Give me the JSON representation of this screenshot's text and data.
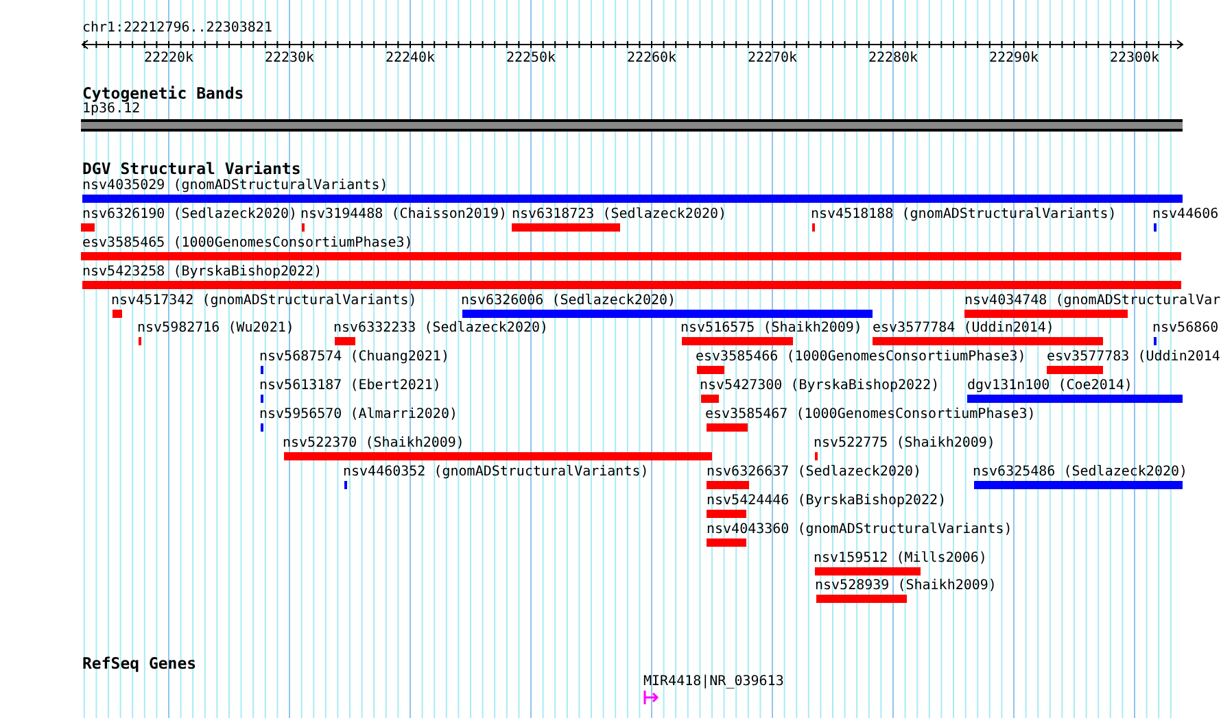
{
  "ruler": {
    "position": "chr1:22212796..22303821",
    "ticks": [
      "22220k",
      "22230k",
      "22240k",
      "22250k",
      "22260k",
      "22270k",
      "22280k",
      "22290k",
      "22300k"
    ]
  },
  "tracks": [
    {
      "kind": "cytoband",
      "title": "Cytogenetic Bands",
      "band": "1p36.12"
    },
    {
      "kind": "variants",
      "title": "DGV Structural Variants",
      "rows": [
        [
          {
            "label": "nsv4035029 (gnomADStructuralVariants)",
            "color": "#0000ff"
          }
        ],
        [
          {
            "label": "nsv6326190 (Sedlazeck2020)",
            "color": "#ff0000"
          },
          {
            "label": "nsv3194488 (Chaisson2019)",
            "color": "#ff0000"
          },
          {
            "label": "nsv6318723 (Sedlazeck2020)",
            "color": "#ff0000"
          },
          {
            "label": "nsv4518188 (gnomADStructuralVariants)",
            "color": "#ff0000"
          },
          {
            "label": "nsv44606",
            "color": "#0000ff"
          }
        ],
        [
          {
            "label": "esv3585465 (1000GenomesConsortiumPhase3)",
            "color": "#ff0000"
          }
        ],
        [
          {
            "label": "nsv5423258 (ByrskaBishop2022)",
            "color": "#ff0000"
          }
        ],
        [
          {
            "label": "nsv4517342 (gnomADStructuralVariants)",
            "color": "#ff0000"
          },
          {
            "label": "nsv6326006 (Sedlazeck2020)",
            "color": "#0000ff"
          },
          {
            "label": "nsv4034748 (gnomADStructuralVar",
            "color": "#ff0000"
          }
        ],
        [
          {
            "label": "nsv5982716 (Wu2021)",
            "color": "#ff0000"
          },
          {
            "label": "nsv6332233 (Sedlazeck2020)",
            "color": "#ff0000"
          },
          {
            "label": "nsv516575 (Shaikh2009)",
            "color": "#ff0000"
          },
          {
            "label": "esv3577784 (Uddin2014)",
            "color": "#ff0000"
          },
          {
            "label": "nsv56860",
            "color": "#0000ff"
          }
        ],
        [
          {
            "label": "nsv5687574 (Chuang2021)",
            "color": "#0000ff"
          },
          {
            "label": "esv3585466 (1000GenomesConsortiumPhase3)",
            "color": "#ff0000"
          },
          {
            "label": "esv3577783 (Uddin2014",
            "color": "#ff0000"
          }
        ],
        [
          {
            "label": "nsv5613187 (Ebert2021)",
            "color": "#0000ff"
          },
          {
            "label": "nsv5427300 (ByrskaBishop2022)",
            "color": "#ff0000"
          },
          {
            "label": "dgv131n100 (Coe2014)",
            "color": "#0000ff"
          }
        ],
        [
          {
            "label": "nsv5956570 (Almarri2020)",
            "color": "#0000ff"
          },
          {
            "label": "esv3585467 (1000GenomesConsortiumPhase3)",
            "color": "#ff0000"
          }
        ],
        [
          {
            "label": "nsv522370 (Shaikh2009)",
            "color": "#ff0000"
          },
          {
            "label": "nsv522775 (Shaikh2009)",
            "color": "#ff0000"
          }
        ],
        [
          {
            "label": "nsv4460352 (gnomADStructuralVariants)",
            "color": "#0000ff"
          },
          {
            "label": "nsv6326637 (Sedlazeck2020)",
            "color": "#ff0000"
          },
          {
            "label": "nsv6325486 (Sedlazeck2020)",
            "color": "#0000ff"
          }
        ],
        [
          {
            "label": "nsv5424446 (ByrskaBishop2022)",
            "color": "#ff0000"
          }
        ],
        [
          {
            "label": "nsv4043360 (gnomADStructuralVariants)",
            "color": "#ff0000"
          }
        ],
        [
          {
            "label": "nsv159512 (Mills2006)",
            "color": "#ff0000"
          }
        ],
        [
          {
            "label": "nsv528939 (Shaikh2009)",
            "color": "#ff0000"
          }
        ]
      ]
    },
    {
      "kind": "genes",
      "title": "RefSeq Genes",
      "genes": [
        {
          "label": "MIR4418|NR_039613"
        }
      ]
    }
  ]
}
